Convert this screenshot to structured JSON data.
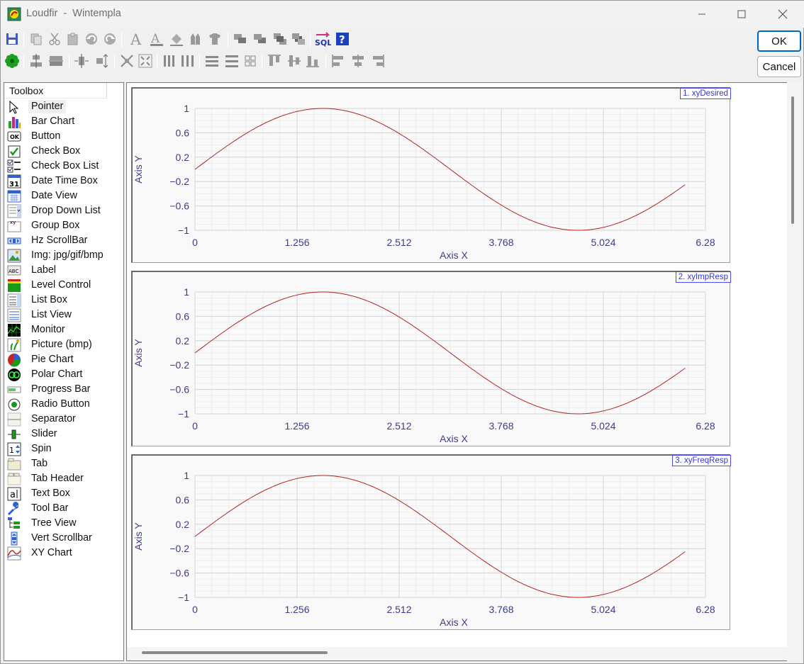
{
  "window": {
    "title": "Loudfir  -  Wintempla",
    "controls": {
      "minimize": "—",
      "maximize": "□",
      "close": "✕"
    }
  },
  "dialog": {
    "ok_label": "OK",
    "cancel_label": "Cancel"
  },
  "toolbar": {
    "row1_icons": [
      "save-icon",
      "copy-icon",
      "cut-icon",
      "paste-icon",
      "undo-icon",
      "redo-icon",
      "font-icon",
      "text-color-icon",
      "fill-color-icon",
      "pen-color-icon",
      "style-icon",
      "bring-forward-icon",
      "send-backward-icon",
      "bring-to-front-icon",
      "send-to-back-icon",
      "sql-icon",
      "help-icon"
    ],
    "row2_icons": [
      "settings-flower-icon",
      "align-center-h-icon",
      "align-center-v-icon",
      "center-h-icon",
      "center-v-icon",
      "shrink-icon",
      "expand-icon",
      "space-h-equal-icon",
      "space-h-fill-icon",
      "space-v-equal-icon",
      "space-v-fill-icon",
      "grid-icon",
      "align-top-icon",
      "align-middle-icon",
      "align-bottom-icon",
      "align-left-icon",
      "align-center-icon",
      "align-right-icon"
    ]
  },
  "toolbox": {
    "header": "Toolbox",
    "items": [
      {
        "label": "Pointer",
        "icon": "pointer-icon",
        "selected": true
      },
      {
        "label": "Bar Chart",
        "icon": "bar-chart-icon"
      },
      {
        "label": "Button",
        "icon": "button-icon"
      },
      {
        "label": "Check Box",
        "icon": "check-box-icon"
      },
      {
        "label": "Check Box List",
        "icon": "check-box-list-icon"
      },
      {
        "label": "Date Time Box",
        "icon": "date-time-box-icon"
      },
      {
        "label": "Date View",
        "icon": "date-view-icon"
      },
      {
        "label": "Drop Down List",
        "icon": "drop-down-list-icon"
      },
      {
        "label": "Group Box",
        "icon": "group-box-icon"
      },
      {
        "label": "Hz ScrollBar",
        "icon": "hz-scrollbar-icon"
      },
      {
        "label": "Img: jpg/gif/bmp",
        "icon": "image-icon"
      },
      {
        "label": "Label",
        "icon": "label-icon"
      },
      {
        "label": "Level Control",
        "icon": "level-control-icon"
      },
      {
        "label": "List Box",
        "icon": "list-box-icon"
      },
      {
        "label": "List View",
        "icon": "list-view-icon"
      },
      {
        "label": "Monitor",
        "icon": "monitor-icon"
      },
      {
        "label": "Picture (bmp)",
        "icon": "picture-icon"
      },
      {
        "label": "Pie Chart",
        "icon": "pie-chart-icon"
      },
      {
        "label": "Polar Chart",
        "icon": "polar-chart-icon"
      },
      {
        "label": "Progress Bar",
        "icon": "progress-bar-icon"
      },
      {
        "label": "Radio Button",
        "icon": "radio-button-icon"
      },
      {
        "label": "Separator",
        "icon": "separator-icon"
      },
      {
        "label": "Slider",
        "icon": "slider-icon"
      },
      {
        "label": "Spin",
        "icon": "spin-icon"
      },
      {
        "label": "Tab",
        "icon": "tab-icon"
      },
      {
        "label": "Tab Header",
        "icon": "tab-header-icon"
      },
      {
        "label": "Text Box",
        "icon": "text-box-icon"
      },
      {
        "label": "Tool Bar",
        "icon": "tool-bar-icon"
      },
      {
        "label": "Tree View",
        "icon": "tree-view-icon"
      },
      {
        "label": "Vert Scrollbar",
        "icon": "vert-scrollbar-icon"
      },
      {
        "label": "XY Chart",
        "icon": "xy-chart-icon"
      }
    ]
  },
  "colors": {
    "accent": "#0067c0",
    "chart_line": "#b22222",
    "axis_text": "#3c3c8c",
    "badge_border": "#4a4aff"
  },
  "chart_data": [
    {
      "type": "line",
      "badge": "1. xyDesired",
      "xlabel": "Axis X",
      "ylabel": "Axis Y",
      "xlim": [
        0,
        6.28
      ],
      "ylim": [
        -1,
        1
      ],
      "xticks": [
        "0",
        "1.256",
        "2.512",
        "3.768",
        "5.024",
        "6.28"
      ],
      "yticks": [
        "1",
        "0.6",
        "0.2",
        "−0.2",
        "−0.6",
        "−1"
      ],
      "grid": true,
      "series": [
        {
          "function": "sin(x)",
          "x_range": [
            0,
            6.03
          ],
          "color": "#b22222"
        }
      ]
    },
    {
      "type": "line",
      "badge": "2. xyImpResp",
      "xlabel": "Axis X",
      "ylabel": "Axis Y",
      "xlim": [
        0,
        6.28
      ],
      "ylim": [
        -1,
        1
      ],
      "xticks": [
        "0",
        "1.256",
        "2.512",
        "3.768",
        "5.024",
        "6.28"
      ],
      "yticks": [
        "1",
        "0.6",
        "0.2",
        "−0.2",
        "−0.6",
        "−1"
      ],
      "grid": true,
      "series": [
        {
          "function": "sin(x)",
          "x_range": [
            0,
            6.03
          ],
          "color": "#b22222"
        }
      ]
    },
    {
      "type": "line",
      "badge": "3. xyFreqResp",
      "xlabel": "Axis X",
      "ylabel": "Axis Y",
      "xlim": [
        0,
        6.28
      ],
      "ylim": [
        -1,
        1
      ],
      "xticks": [
        "0",
        "1.256",
        "2.512",
        "3.768",
        "5.024",
        "6.28"
      ],
      "yticks": [
        "1",
        "0.6",
        "0.2",
        "−0.2",
        "−0.6",
        "−1"
      ],
      "grid": true,
      "series": [
        {
          "function": "sin(x)",
          "x_range": [
            0,
            6.03
          ],
          "color": "#b22222"
        }
      ]
    }
  ]
}
